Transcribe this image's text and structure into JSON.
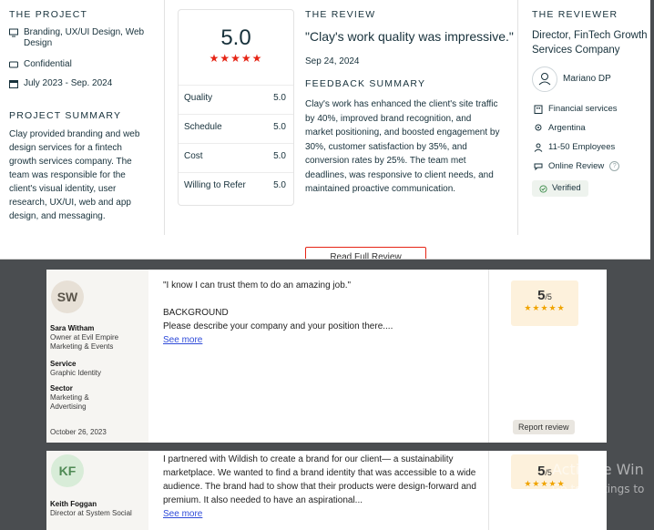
{
  "project": {
    "heading": "THE PROJECT",
    "service": "Branding, UX/UI Design, Web Design",
    "budget": "Confidential",
    "dates": "July 2023 - Sep. 2024",
    "summary_heading": "PROJECT SUMMARY",
    "summary": "Clay provided branding and web design services for a fintech growth services company. The team was responsible for the client's visual identity, user research, UX/UI, web and app design, and messaging."
  },
  "scores": {
    "overall": "5.0",
    "stars": "★★★★★",
    "rows": [
      {
        "label": "Quality",
        "value": "5.0"
      },
      {
        "label": "Schedule",
        "value": "5.0"
      },
      {
        "label": "Cost",
        "value": "5.0"
      },
      {
        "label": "Willing to Refer",
        "value": "5.0"
      }
    ]
  },
  "review": {
    "heading": "THE REVIEW",
    "quote": "\"Clay's work quality was impressive.\"",
    "date": "Sep 24, 2024",
    "feedback_heading": "FEEDBACK SUMMARY",
    "feedback": "Clay's work has enhanced the client's site traffic by 40%, improved brand recognition, and market positioning, and boosted engagement by 30%, customer satisfaction by 35%, and conversion rates by 25%. The team met deadlines, was responsive to client needs, and maintained proactive communication.",
    "read_more": "Read Full Review"
  },
  "reviewer": {
    "heading": "THE REVIEWER",
    "title": "Director, FinTech Growth Services Company",
    "name": "Mariano DP",
    "industry": "Financial services",
    "location": "Argentina",
    "size": "11-50 Employees",
    "review_type": "Online Review",
    "verified": "Verified"
  },
  "card1": {
    "initials": "SW",
    "name": "Sara Witham",
    "role": "Owner at Evil Empire Marketing & Events",
    "service_label": "Service",
    "service": "Graphic Identity",
    "sector_label": "Sector",
    "sector": "Marketing & Advertising",
    "date": "October 26, 2023",
    "quote": "\"I know I can trust them to do an amazing job.\"",
    "background_label": "BACKGROUND",
    "background": "Please describe your company and your position there....",
    "see_more": "See more",
    "rating": "5",
    "rating_max": "/5",
    "stars": "★★★★★",
    "report": "Report review"
  },
  "card2": {
    "initials": "KF",
    "name": "Keith Foggan",
    "role": "Director at System Social",
    "text": "I partnered with Wildish to create a brand for our client— a sustainability marketplace. We wanted to find a brand identity that was accessible to a wide audience. The brand had to show that their products were design-forward and premium. It also needed to have an aspirational...",
    "see_more": "See more",
    "rating": "5",
    "rating_max": "/5",
    "stars": "★★★★★"
  },
  "watermark": {
    "line1": "Activate Win",
    "line2": "Go to Settings to"
  },
  "colors": {
    "accent_red": "#e62415",
    "star_gold": "#f0a400",
    "link_blue": "#2f4bd9"
  }
}
